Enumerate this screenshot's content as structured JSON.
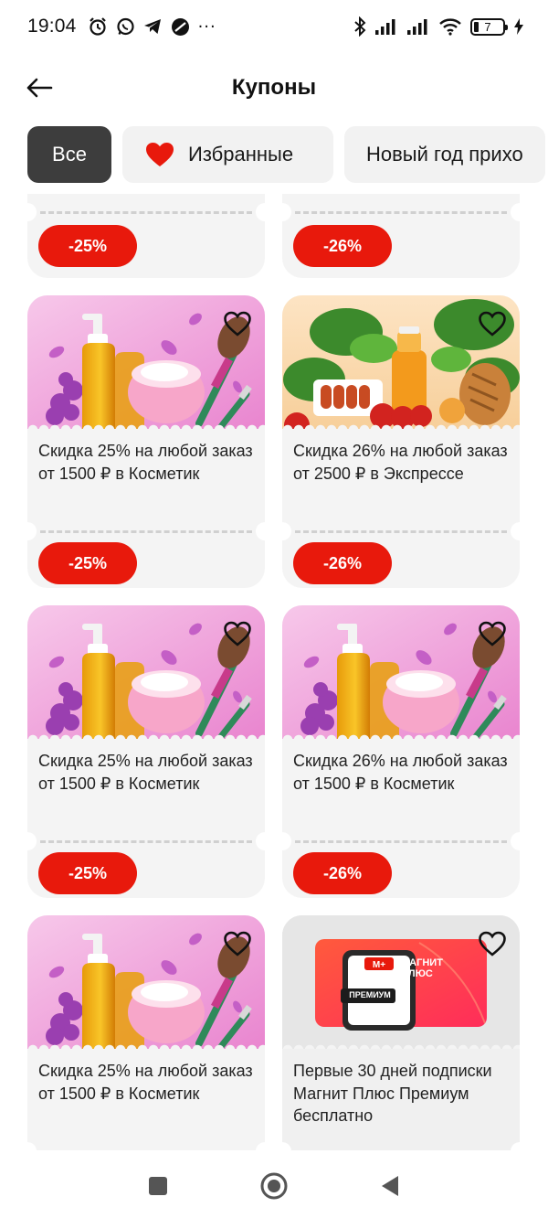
{
  "status_bar": {
    "time": "19:04",
    "more": "···",
    "battery_level": "7",
    "icons": [
      "alarm-icon",
      "whatsapp-icon",
      "telegram-icon",
      "app-icon",
      "bluetooth-icon",
      "signal-icon",
      "signal-icon",
      "wifi-icon",
      "battery-icon",
      "charging-icon"
    ]
  },
  "header": {
    "title": "Купоны",
    "back_icon": "arrow-left-icon"
  },
  "filters": {
    "all": "Все",
    "favorites": "Избранные",
    "new_year": "Новый год прихо"
  },
  "coupons": [
    {
      "title": "",
      "discount": "-25%",
      "image": "cosmetics"
    },
    {
      "title": "",
      "discount": "-26%",
      "image": "cosmetics"
    },
    {
      "title": "Скидка 25% на любой заказ от 1500 ₽ в Косметик",
      "discount": "-25%",
      "image": "cosmetics"
    },
    {
      "title": "Скидка 26% на любой заказ от 2500 ₽ в Экспрессе",
      "discount": "-26%",
      "image": "groceries"
    },
    {
      "title": "Скидка 25% на любой заказ от 1500 ₽ в Косметик",
      "discount": "-25%",
      "image": "cosmetics"
    },
    {
      "title": "Скидка 26% на любой заказ от 1500 ₽ в Косметик",
      "discount": "-26%",
      "image": "cosmetics"
    },
    {
      "title": "Скидка 25% на любой заказ от 1500 ₽ в Косметик",
      "discount": "",
      "image": "cosmetics"
    },
    {
      "title": "Первые 30 дней подписки Магнит Плюс Премиум бесплатно",
      "discount": "",
      "image": "subscription-card"
    }
  ],
  "promo_card": {
    "brand_line1": "МАГНИТ",
    "brand_line2": "ПЛЮС",
    "tag": "ПРЕМИУМ"
  },
  "colors": {
    "accent_red": "#e8190c",
    "chip_active": "#3d3d3d",
    "card_bg": "#f4f4f4"
  },
  "nav": [
    "recents-square-icon",
    "home-circle-icon",
    "back-triangle-icon"
  ]
}
